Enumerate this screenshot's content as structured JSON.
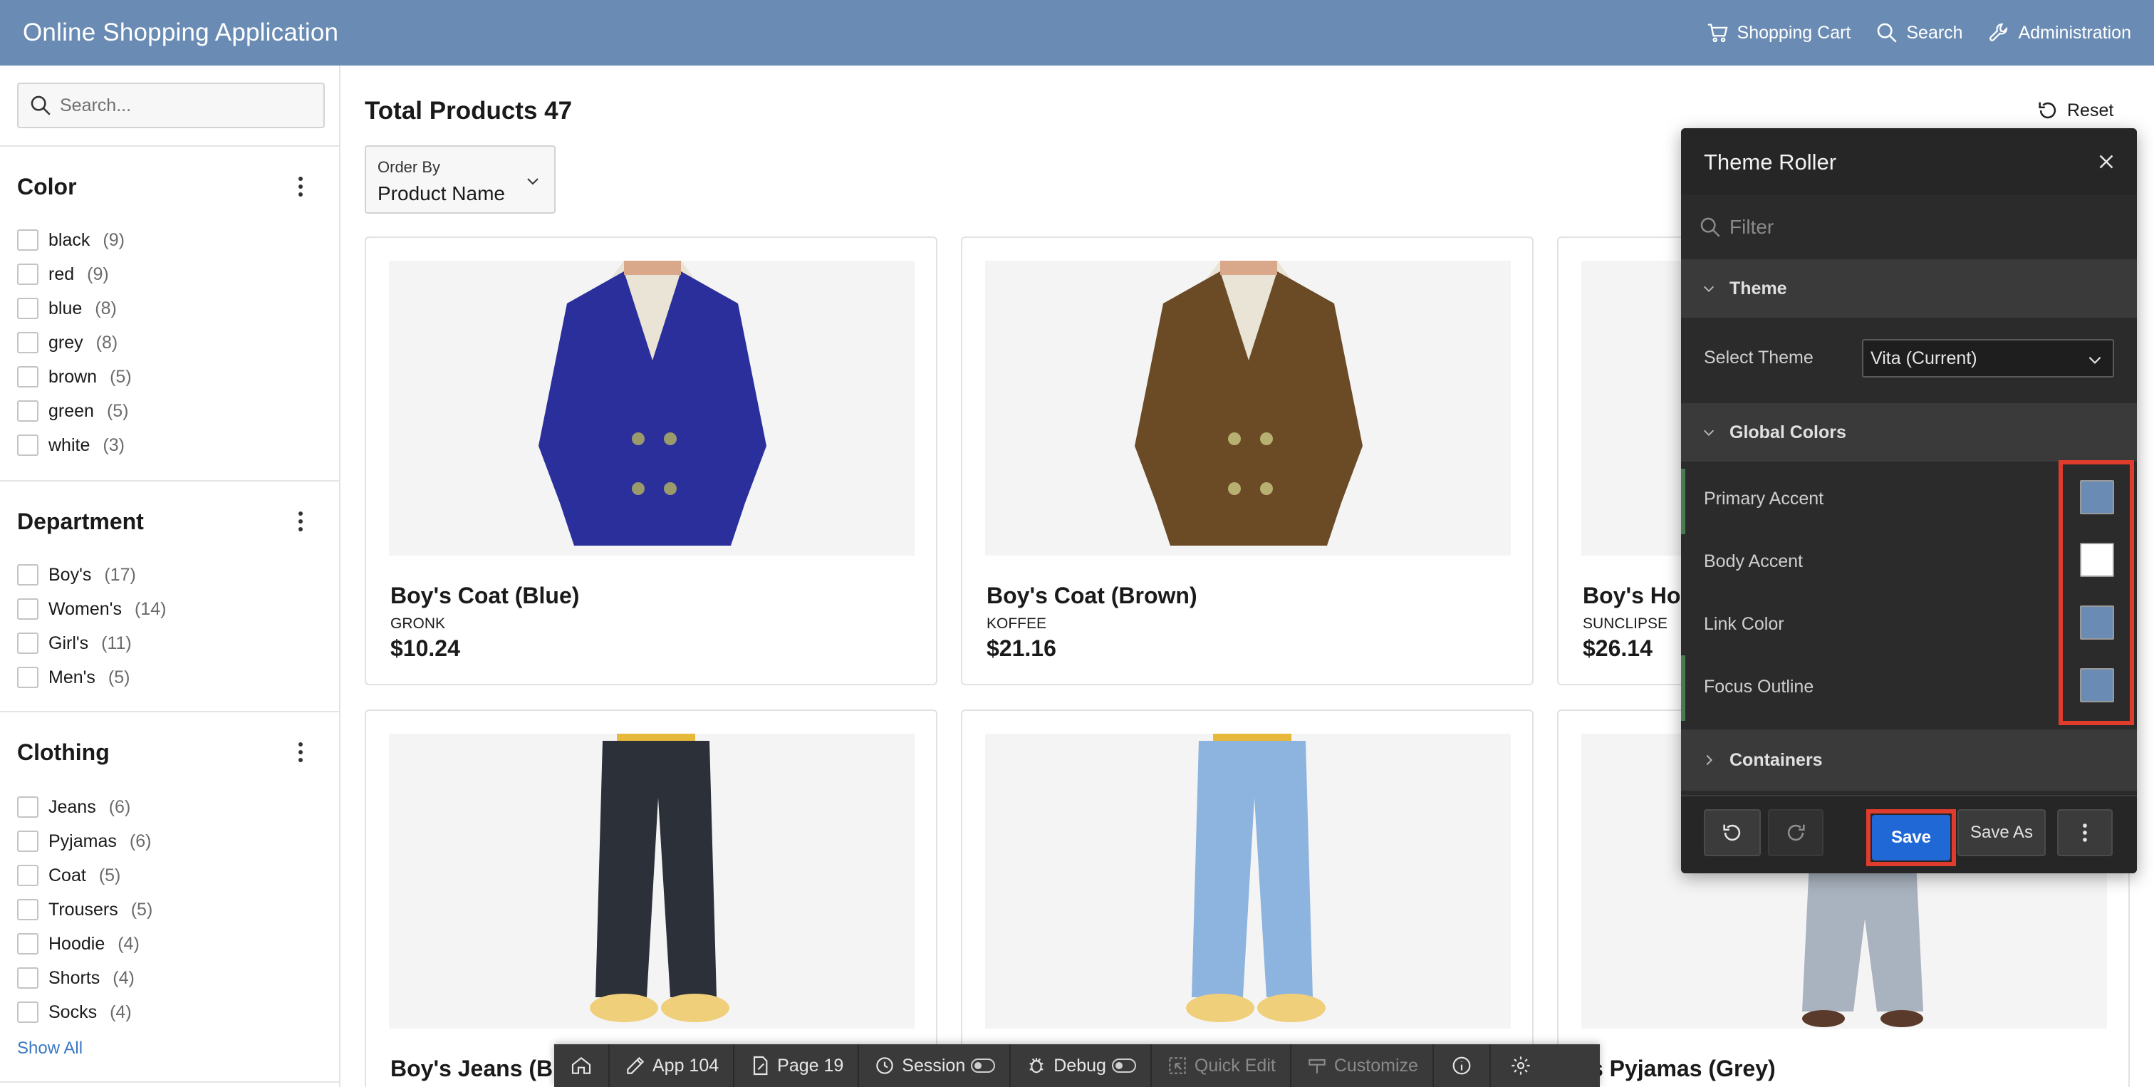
{
  "header": {
    "title": "Online Shopping Application",
    "nav": [
      {
        "icon": "cart-icon",
        "label": "Shopping Cart"
      },
      {
        "icon": "search-icon",
        "label": "Search"
      },
      {
        "icon": "wrench-icon",
        "label": "Administration"
      }
    ]
  },
  "sidebar": {
    "search_placeholder": "Search...",
    "facets": [
      {
        "title": "Color",
        "items": [
          {
            "label": "black",
            "count": "(9)"
          },
          {
            "label": "red",
            "count": "(9)"
          },
          {
            "label": "blue",
            "count": "(8)"
          },
          {
            "label": "grey",
            "count": "(8)"
          },
          {
            "label": "brown",
            "count": "(5)"
          },
          {
            "label": "green",
            "count": "(5)"
          },
          {
            "label": "white",
            "count": "(3)"
          }
        ]
      },
      {
        "title": "Department",
        "items": [
          {
            "label": "Boy's",
            "count": "(17)"
          },
          {
            "label": "Women's",
            "count": "(14)"
          },
          {
            "label": "Girl's",
            "count": "(11)"
          },
          {
            "label": "Men's",
            "count": "(5)"
          }
        ]
      },
      {
        "title": "Clothing",
        "items": [
          {
            "label": "Jeans",
            "count": "(6)"
          },
          {
            "label": "Pyjamas",
            "count": "(6)"
          },
          {
            "label": "Coat",
            "count": "(5)"
          },
          {
            "label": "Trousers",
            "count": "(5)"
          },
          {
            "label": "Hoodie",
            "count": "(4)"
          },
          {
            "label": "Shorts",
            "count": "(4)"
          },
          {
            "label": "Socks",
            "count": "(4)"
          }
        ],
        "show_all": "Show All"
      }
    ]
  },
  "main": {
    "total_label": "Total Products 47",
    "reset_label": "Reset",
    "order_by": {
      "label": "Order By",
      "value": "Product Name"
    },
    "products": [
      {
        "name": "Boy's Coat (Blue)",
        "brand": "GRONK",
        "price": "$10.24",
        "color": "#2a2f9c"
      },
      {
        "name": "Boy's Coat (Brown)",
        "brand": "KOFFEE",
        "price": "$21.16",
        "color": "#6b4a26"
      },
      {
        "name": "Boy's Ho",
        "brand": "SUNCLIPSE",
        "price": "$26.14",
        "color": "#c9c9c9"
      },
      {
        "name": "Boy's Jeans (Bl",
        "brand": "",
        "price": "",
        "color": "#2c3038"
      },
      {
        "name": "",
        "brand": "",
        "price": "",
        "color": "#8db4de"
      },
      {
        "name": "oy's Pyjamas (Grey)",
        "brand": "",
        "price": "",
        "color": "#a9b2bf"
      }
    ]
  },
  "theme_roller": {
    "title": "Theme Roller",
    "filter_placeholder": "Filter",
    "sections": {
      "theme": "Theme",
      "global_colors": "Global Colors",
      "containers": "Containers"
    },
    "select_theme_label": "Select Theme",
    "select_theme_value": "Vita (Current)",
    "colors": [
      {
        "label": "Primary Accent",
        "value": "#6a8cb4"
      },
      {
        "label": "Body Accent",
        "value": "#ffffff"
      },
      {
        "label": "Link Color",
        "value": "#6a8cb4"
      },
      {
        "label": "Focus Outline",
        "value": "#6a8cb4"
      }
    ],
    "save_label": "Save",
    "save_as_label": "Save As"
  },
  "devbar": {
    "items": [
      {
        "icon": "home-icon",
        "label": ""
      },
      {
        "icon": "edit-icon",
        "label": "App 104"
      },
      {
        "icon": "page-edit-icon",
        "label": "Page 19"
      },
      {
        "icon": "session-icon",
        "label": "Session"
      },
      {
        "icon": "debug-icon",
        "label": "Debug"
      },
      {
        "icon": "quick-edit-icon",
        "label": "Quick Edit"
      },
      {
        "icon": "customize-icon",
        "label": "Customize"
      },
      {
        "icon": "info-icon",
        "label": ""
      },
      {
        "icon": "gear-icon",
        "label": ""
      }
    ]
  },
  "colors": {
    "header_bg": "#6a8cb4",
    "highlight": "#e03c2d",
    "save_blue": "#1f68d6",
    "link": "#3c78c2"
  }
}
